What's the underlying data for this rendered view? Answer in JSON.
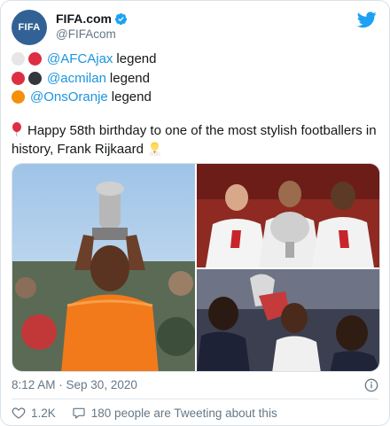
{
  "account": {
    "avatar_text": "FIFA",
    "display_name": "FIFA.com",
    "handle": "@FIFAcom"
  },
  "icons": {
    "platform": "twitter-bird-icon",
    "verified": "verified-badge-icon",
    "info": "info-icon",
    "like": "heart-icon",
    "reply": "speech-bubble-icon"
  },
  "colors": {
    "accent": "#1b95e0",
    "twitter_blue": "#1da1f2",
    "fifa_blue": "#326295",
    "muted_text": "#657786"
  },
  "tweet": {
    "lines": [
      {
        "dots": [
          "white-circle",
          "red-circle"
        ],
        "mention": "@AFCAjax",
        "suffix": "legend"
      },
      {
        "dots": [
          "red-circle",
          "black-circle"
        ],
        "mention": "@acmilan",
        "suffix": "legend"
      },
      {
        "dots": [
          "orange-circle"
        ],
        "mention": "@OnsOranje",
        "suffix": "legend"
      }
    ],
    "birthday_text": "Happy 58th birthday to one of the most stylish footballers in history, Frank Rijkaard"
  },
  "media": {
    "photos": [
      "photo-rijkaard-trophy-orange",
      "photo-milan-trio-cup",
      "photo-ajax-celebration"
    ]
  },
  "timestamp": "8:12 AM · Sep 30, 2020",
  "actions": {
    "likes": "1.2K",
    "conversation": "180 people are Tweeting about this"
  }
}
